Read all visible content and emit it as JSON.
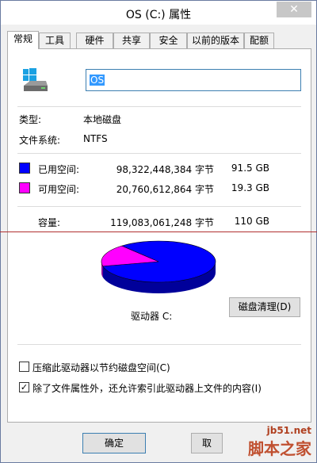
{
  "window": {
    "title": "OS (C:) 属性",
    "close_glyph": "✕"
  },
  "tabs": [
    {
      "label": "常规"
    },
    {
      "label": "工具"
    },
    {
      "label": "硬件"
    },
    {
      "label": "共享"
    },
    {
      "label": "安全"
    },
    {
      "label": "以前的版本"
    },
    {
      "label": "配额"
    }
  ],
  "drive": {
    "name_value": "OS",
    "icon": "drive-with-windows-logo-icon"
  },
  "info": {
    "type_label": "类型:",
    "type_value": "本地磁盘",
    "fs_label": "文件系统:",
    "fs_value": "NTFS"
  },
  "usage": {
    "used_label": "已用空间:",
    "used_bytes": "98,322,448,384 字节",
    "used_gb": "91.5 GB",
    "used_color": "#0000ff",
    "free_label": "可用空间:",
    "free_bytes": "20,760,612,864 字节",
    "free_gb": "19.3 GB",
    "free_color": "#ff00ff",
    "capacity_label": "容量:",
    "capacity_bytes": "119,083,061,248 字节",
    "capacity_gb": "110 GB",
    "used_fraction": 0.826
  },
  "drive_label": "驱动器 C:",
  "cleanup_button": "磁盘清理(D)",
  "options": {
    "compress_label": "压缩此驱动器以节约磁盘空间(C)",
    "compress_checked": false,
    "index_label": "除了文件属性外，还允许索引此驱动器上文件的内容(I)",
    "index_checked": true
  },
  "buttons": {
    "ok": "确定",
    "cancel": "取"
  },
  "watermark": {
    "line1": "jb51.net",
    "line2": "脚本之家"
  }
}
